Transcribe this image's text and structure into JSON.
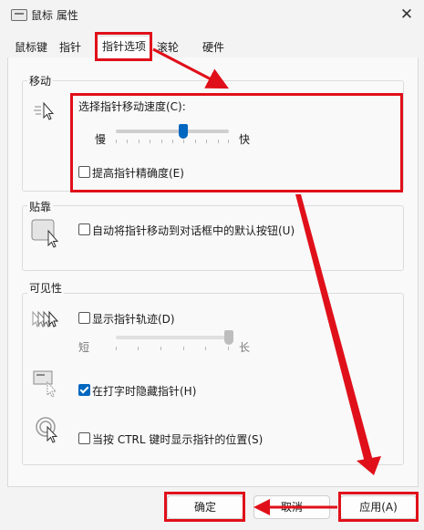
{
  "window": {
    "title": "鼠标 属性",
    "close_glyph": "✕"
  },
  "tabs": [
    {
      "label": "鼠标键"
    },
    {
      "label": "指针"
    },
    {
      "label": "指针选项",
      "selected": true
    },
    {
      "label": "滚轮"
    },
    {
      "label": "硬件"
    }
  ],
  "motion": {
    "group_title": "移动",
    "speed_label": "选择指针移动速度(C):",
    "slow_label": "慢",
    "fast_label": "快",
    "speed_value": 0.6,
    "enhance_label": "提高指针精确度(E)",
    "enhance_checked": false
  },
  "snap": {
    "group_title": "贴靠",
    "label": "自动将指针移动到对话框中的默认按钮(U)",
    "checked": false
  },
  "visibility": {
    "group_title": "可见性",
    "trails_label": "显示指针轨迹(D)",
    "trails_checked": false,
    "short_label": "短",
    "long_label": "长",
    "trail_value": 1.0,
    "hide_label": "在打字时隐藏指针(H)",
    "hide_checked": true,
    "ctrl_label": "当按 CTRL 键时显示指针的位置(S)",
    "ctrl_checked": false
  },
  "buttons": {
    "ok": "确定",
    "cancel": "取消",
    "apply": "应用(A)"
  },
  "colors": {
    "annotation": "#e0101a",
    "accent": "#0067c0"
  }
}
